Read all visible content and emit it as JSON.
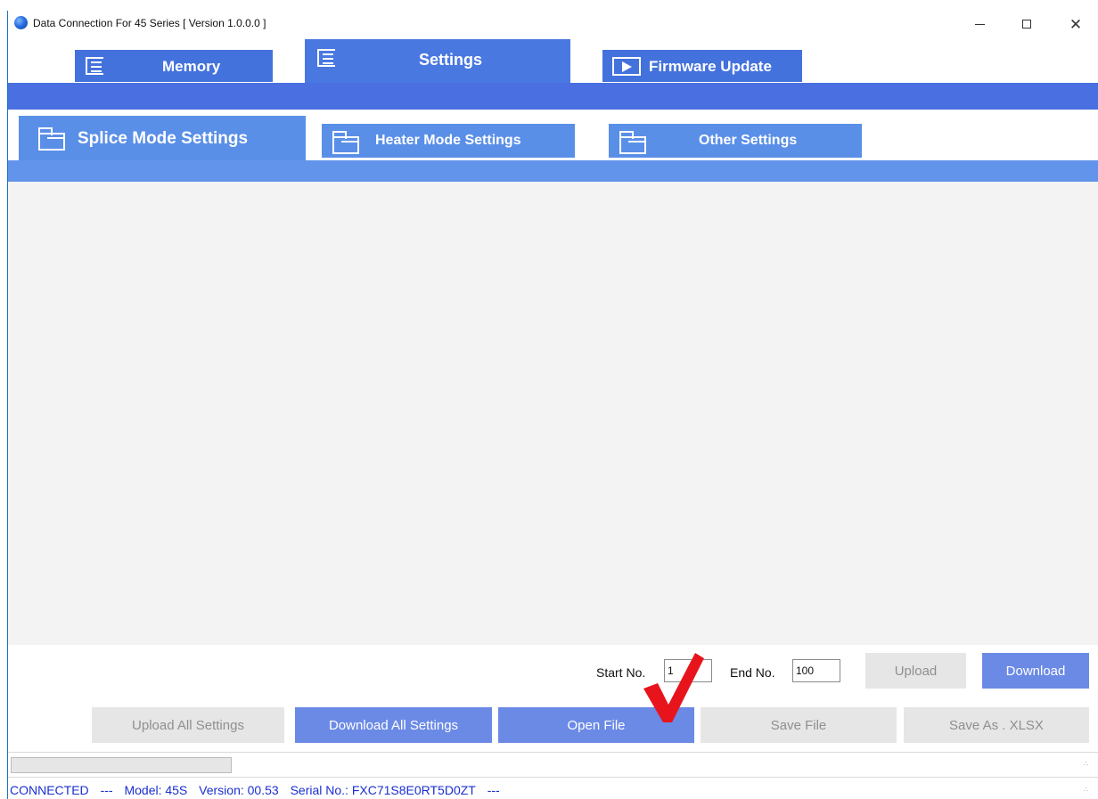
{
  "window": {
    "title": "Data Connection For 45 Series [ Version 1.0.0.0 ]"
  },
  "main_tabs": [
    {
      "label": "Memory"
    },
    {
      "label": "Settings"
    },
    {
      "label": "Firmware Update"
    }
  ],
  "sub_tabs": [
    {
      "label": "Splice Mode Settings"
    },
    {
      "label": "Heater Mode Settings"
    },
    {
      "label": "Other Settings"
    }
  ],
  "range": {
    "start_label": "Start No.",
    "start_value": "1",
    "end_label": "End No.",
    "end_value": "100"
  },
  "buttons": {
    "upload": "Upload",
    "download": "Download",
    "upload_all": "Upload All Settings",
    "download_all": "Download All Settings",
    "open_file": "Open File",
    "save_file": "Save File",
    "save_xlsx": "Save As . XLSX"
  },
  "progress": {
    "value": 0
  },
  "status": {
    "connection": "CONNECTED",
    "sep": "---",
    "model": "Model: 45S",
    "version": "Version: 00.53",
    "serial": "Serial No.: FXC71S8E0RT5D0ZT",
    "end": "---"
  },
  "colors": {
    "tab_blue": "#4472dd",
    "band_blue": "#4a6fe0",
    "sub_tab_blue": "#5a8fe8",
    "status_text": "#1a2fd0",
    "checkmark": "#e8141c"
  },
  "icons": {
    "app": "app-globe-icon",
    "memory": "list-icon",
    "settings": "list-icon",
    "firmware": "play-icon",
    "sub_tabs": "folder-icon",
    "annotation": "checkmark-icon"
  }
}
